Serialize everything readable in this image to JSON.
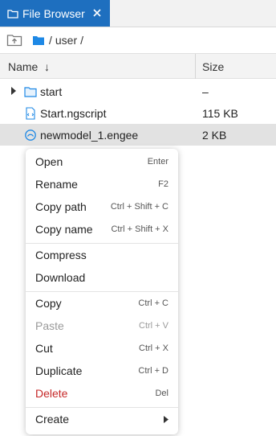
{
  "tab": {
    "title": "File Browser"
  },
  "breadcrumb": {
    "sep1": "/",
    "dir": "user",
    "sep2": "/"
  },
  "table": {
    "headers": {
      "name": "Name",
      "sort_indicator": "↓",
      "size": "Size"
    },
    "rows": [
      {
        "name": "start",
        "size": "–",
        "type": "folder"
      },
      {
        "name": "Start.ngscript",
        "size": "115 KB",
        "type": "script"
      },
      {
        "name": "newmodel_1.engee",
        "size": "2 KB",
        "type": "model",
        "selected": true
      }
    ]
  },
  "menu": {
    "open": {
      "label": "Open",
      "shortcut": "Enter"
    },
    "rename": {
      "label": "Rename",
      "shortcut": "F2"
    },
    "copy_path": {
      "label": "Copy path",
      "shortcut": "Ctrl + Shift + C"
    },
    "copy_name": {
      "label": "Copy name",
      "shortcut": "Ctrl + Shift + X"
    },
    "compress": {
      "label": "Compress"
    },
    "download": {
      "label": "Download"
    },
    "copy": {
      "label": "Copy",
      "shortcut": "Ctrl + C"
    },
    "paste": {
      "label": "Paste",
      "shortcut": "Ctrl + V",
      "disabled": true
    },
    "cut": {
      "label": "Cut",
      "shortcut": "Ctrl + X"
    },
    "duplicate": {
      "label": "Duplicate",
      "shortcut": "Ctrl + D"
    },
    "delete": {
      "label": "Delete",
      "shortcut": "Del"
    },
    "create": {
      "label": "Create"
    }
  },
  "colors": {
    "accent": "#1e6fbf",
    "danger": "#c62828",
    "selected_row": "#e2e2e2",
    "folder": "#1e88e5"
  }
}
